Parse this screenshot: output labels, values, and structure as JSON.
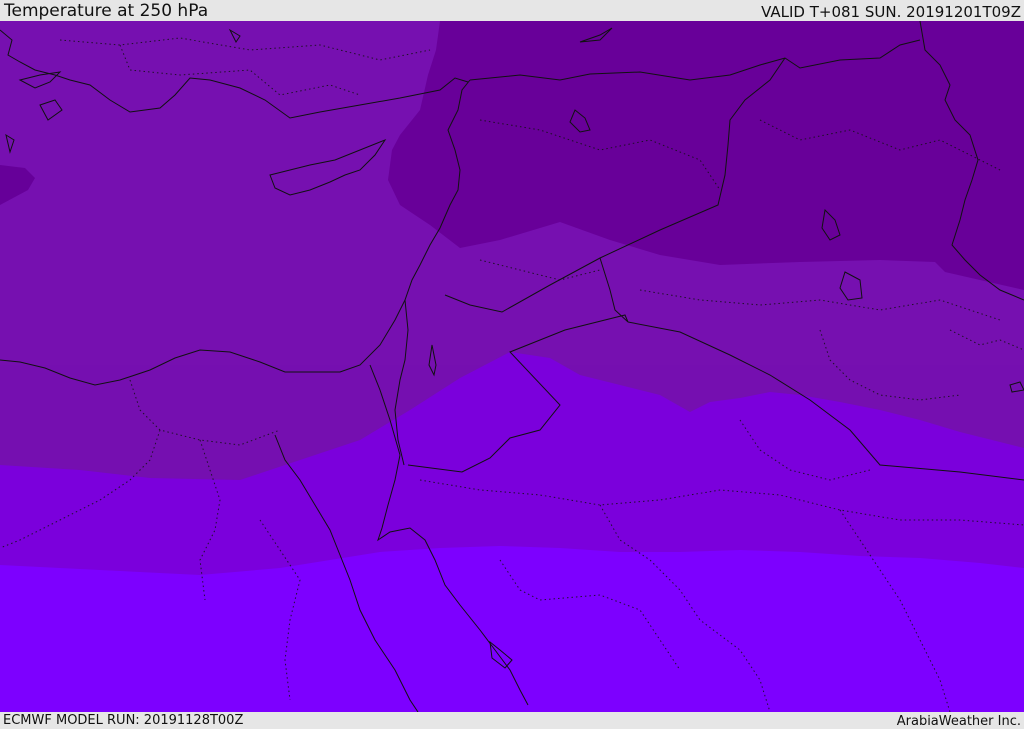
{
  "header": {
    "title": "Temperature at 250 hPa",
    "valid_time": "VALID T+081 SUN. 20191201T09Z"
  },
  "footer": {
    "model_run": "ECMWF MODEL RUN: 20191128T00Z",
    "credit": "ArabiaWeather Inc."
  },
  "map": {
    "region": "Eastern Mediterranean and Middle East",
    "fill_colors": [
      "#680099",
      "#7610b0",
      "#7a00dd",
      "#7d00ff"
    ],
    "line_color": "#111111"
  }
}
